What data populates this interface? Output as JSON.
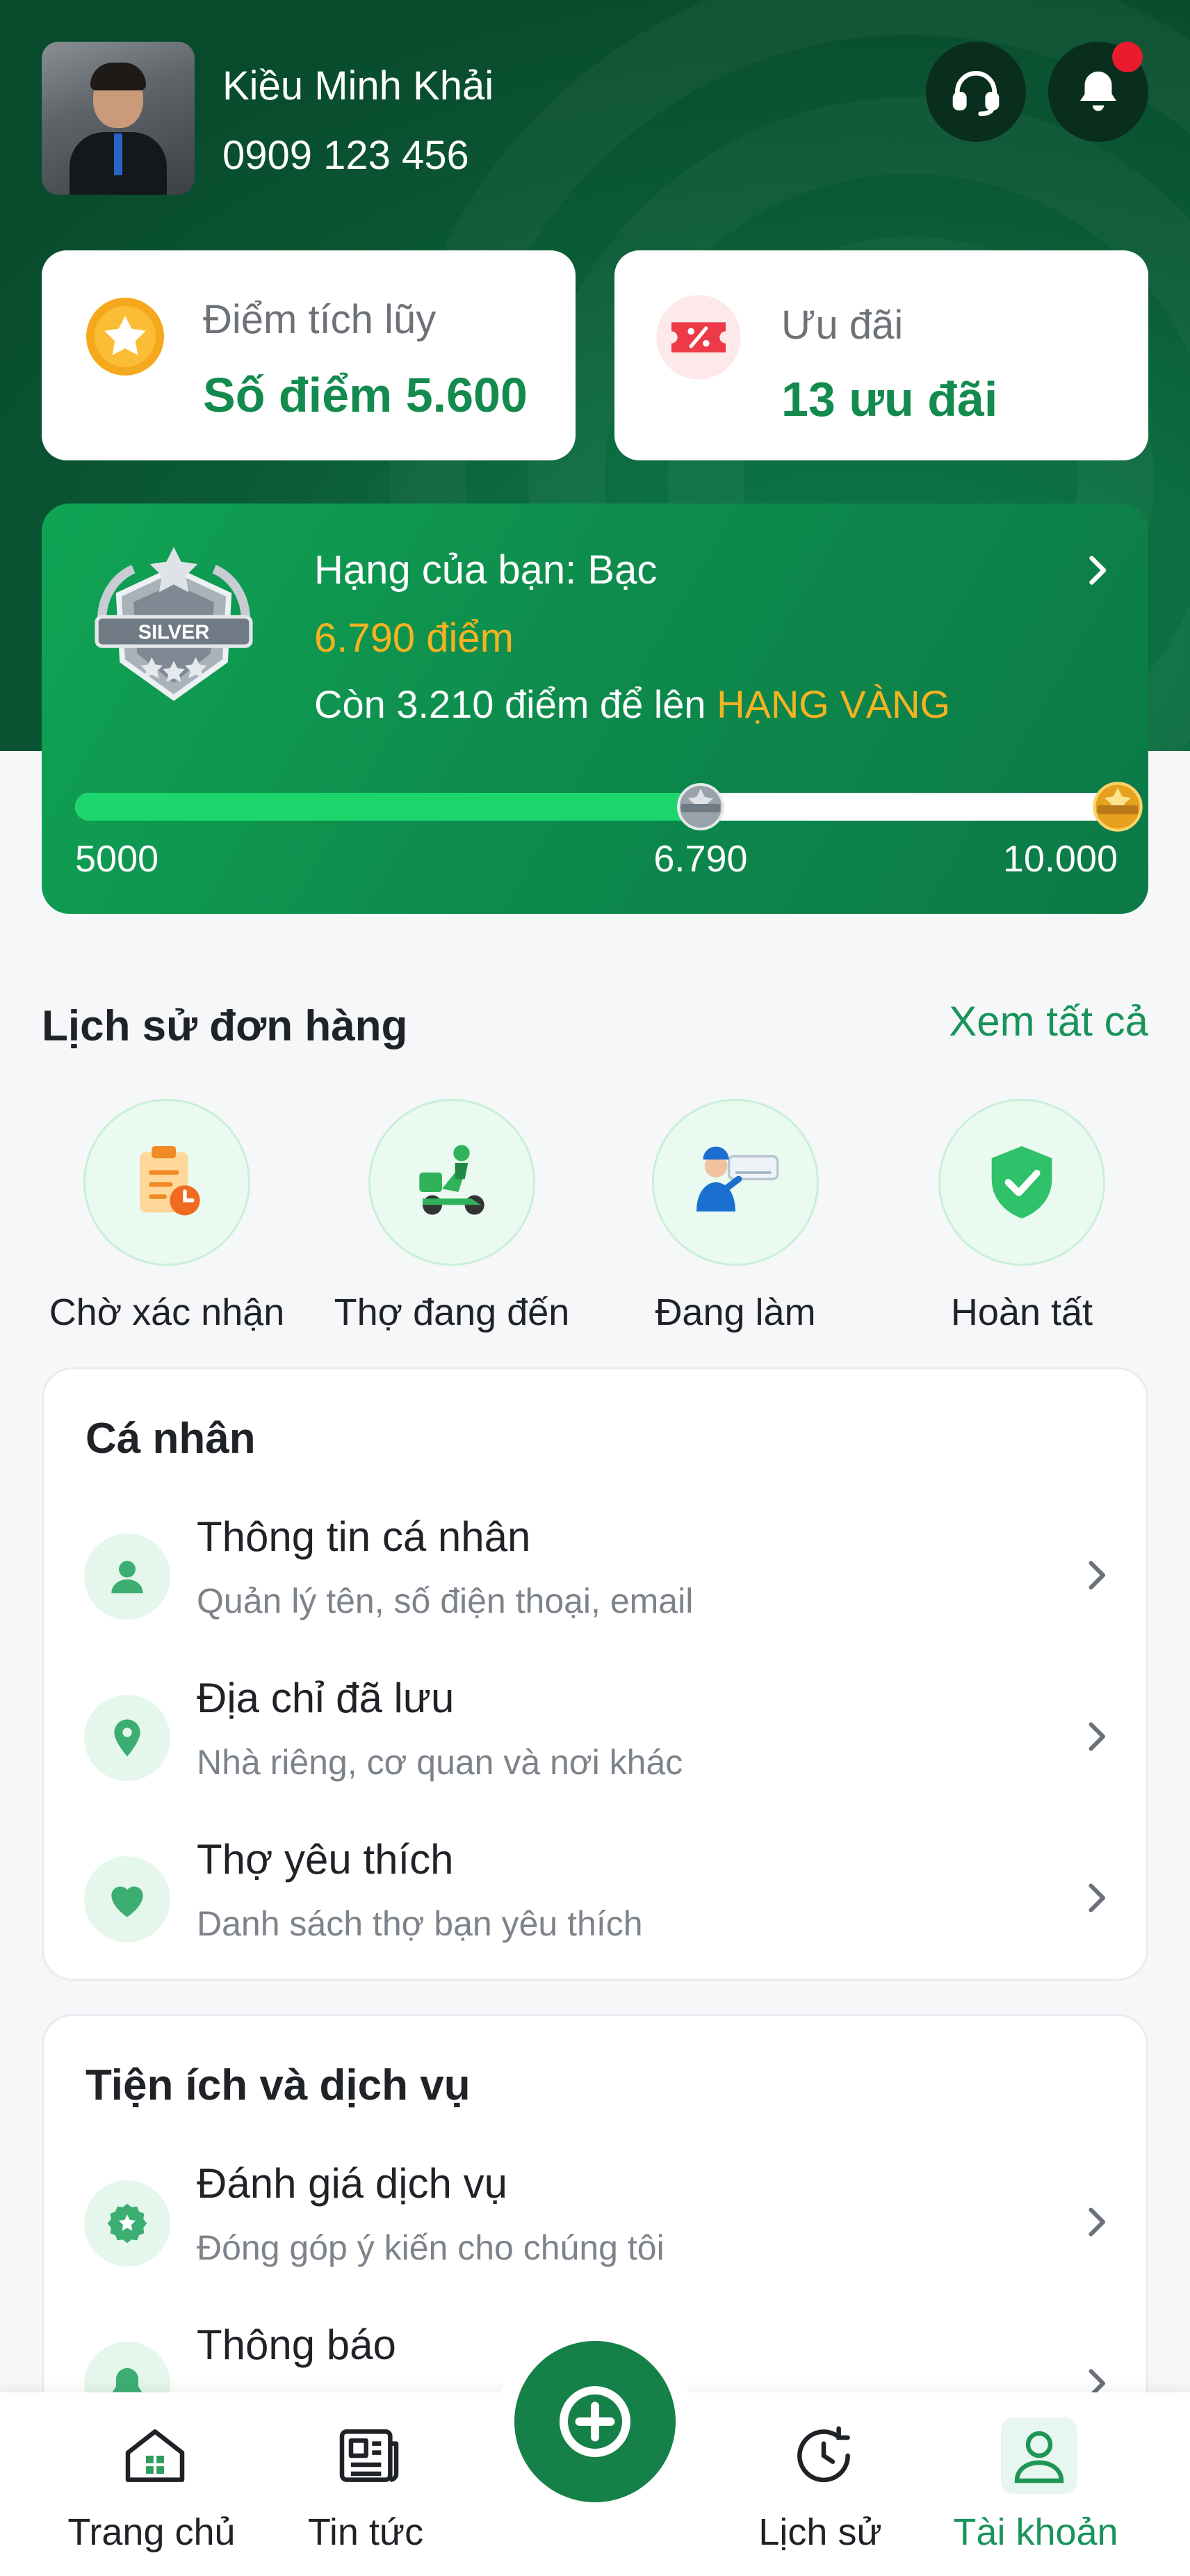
{
  "profile": {
    "name": "Kiều Minh Khải",
    "phone": "0909 123 456"
  },
  "header_icons": [
    "headset-icon",
    "bell-icon"
  ],
  "stats": {
    "points_label": "Điểm tích lũy",
    "points_value": "Số điểm 5.600",
    "offers_label": "Ưu đãi",
    "offers_value": "13 ưu đãi"
  },
  "rank": {
    "badge_text": "SILVER",
    "title": "Hạng của bạn: Bạc",
    "points": "6.790 điểm",
    "remain_prefix": "Còn 3.210 điểm để lên ",
    "next_tier": "HẠNG VÀNG",
    "progress_fraction": 0.6,
    "progress_min_label": "5000",
    "progress_current_label": "6.790",
    "progress_max_label": "10.000"
  },
  "orders": {
    "title": "Lịch sử đơn hàng",
    "see_all": "Xem tất cả",
    "items": [
      {
        "label": "Chờ xác nhận",
        "icon": "clipboard-clock-icon"
      },
      {
        "label": "Thợ đang đến",
        "icon": "scooter-rider-icon"
      },
      {
        "label": "Đang làm",
        "icon": "ac-technician-icon"
      },
      {
        "label": "Hoàn tất",
        "icon": "shield-check-icon"
      }
    ]
  },
  "personal": {
    "title": "Cá nhân",
    "items": [
      {
        "title": "Thông tin cá nhân",
        "subtitle": "Quản lý tên, số điện thoại, email",
        "icon": "user-icon"
      },
      {
        "title": "Địa chỉ đã lưu",
        "subtitle": "Nhà riêng, cơ quan và nơi khác",
        "icon": "location-pin-icon"
      },
      {
        "title": "Thợ yêu thích",
        "subtitle": "Danh sách thợ bạn yêu thích",
        "icon": "heart-icon"
      }
    ]
  },
  "utilities": {
    "title": "Tiện ích và dịch vụ",
    "items": [
      {
        "title": "Đánh giá dịch vụ",
        "subtitle": "Đóng góp ý kiến cho chúng tôi",
        "icon": "star-badge-icon"
      },
      {
        "title": "Thông báo",
        "subtitle": "",
        "icon": "bell-icon"
      }
    ]
  },
  "nav": {
    "items": [
      {
        "label": "Trang chủ",
        "icon": "home-icon"
      },
      {
        "label": "Tin tức",
        "icon": "newspaper-icon"
      },
      {
        "label": "",
        "icon": "plus-icon"
      },
      {
        "label": "Lịch sử",
        "icon": "history-icon"
      },
      {
        "label": "Tài khoản",
        "icon": "account-icon",
        "active": true
      }
    ]
  },
  "colors": {
    "brand_green": "#138a4e",
    "gold": "#f6b221",
    "progress_fill": "#1cd66d",
    "notification_red": "#ea1b2c"
  }
}
